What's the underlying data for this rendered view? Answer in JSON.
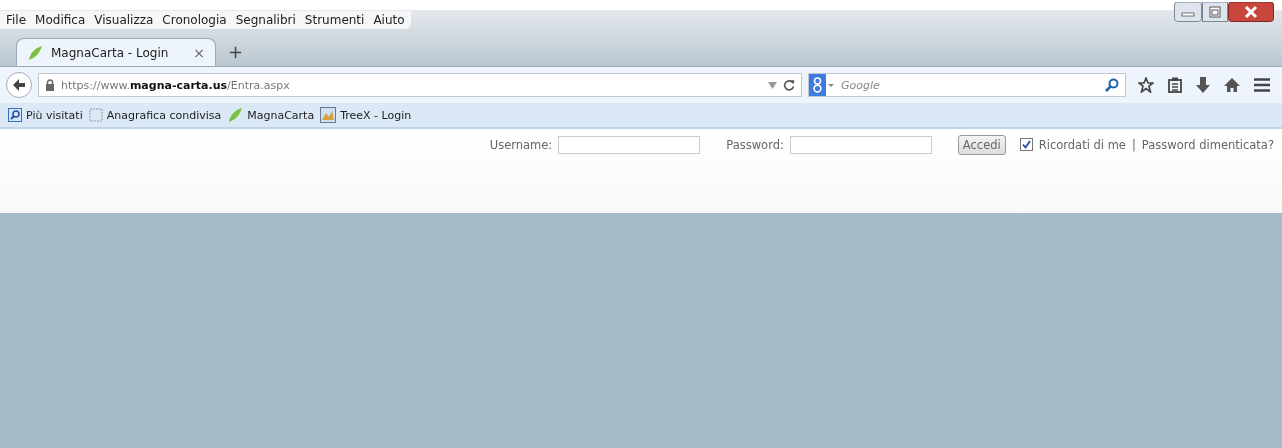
{
  "menu": [
    {
      "label": "File"
    },
    {
      "label": "Modifica"
    },
    {
      "label": "Visualizza"
    },
    {
      "label": "Cronologia"
    },
    {
      "label": "Segnalibri"
    },
    {
      "label": "Strumenti"
    },
    {
      "label": "Aiuto"
    }
  ],
  "tabs": [
    {
      "label": "MagnaCarta - Login",
      "selected": true,
      "close": "×"
    }
  ],
  "new_tab": "+",
  "address": {
    "url": "https://www.**magna-carta.us**/Entra.aspx"
  },
  "search": {
    "placeholder": "Google"
  },
  "bookmarks": [
    {
      "label": "Più visitati",
      "kind": "magnifier"
    },
    {
      "label": "Anagrafica condivisa",
      "kind": "blank"
    },
    {
      "label": "MagnaCarta",
      "kind": "leaf"
    },
    {
      "label": "TreeX - Login",
      "kind": "image"
    }
  ],
  "login": {
    "username_label": "Username:",
    "password_label": "Password:",
    "button": "Accedi",
    "remember": {
      "label": "Ricordati di me",
      "checked": true
    },
    "separator": "|",
    "forgot_link": "Password dimenticata?"
  }
}
